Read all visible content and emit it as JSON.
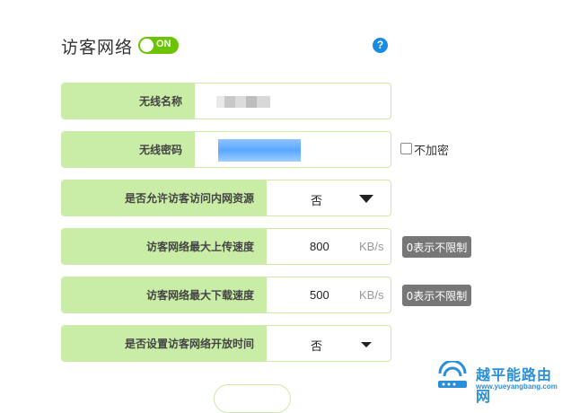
{
  "header": {
    "title": "访客网络",
    "toggle_label": "ON",
    "help_symbol": "?"
  },
  "fields": {
    "ssid": {
      "label": "无线名称"
    },
    "password": {
      "label": "无线密码",
      "no_encrypt_label": "不加密"
    },
    "intranet_access": {
      "label": "是否允许访客访问内网资源",
      "value": "否"
    },
    "upload_limit": {
      "label": "访客网络最大上传速度",
      "value": "800",
      "unit": "KB/s",
      "hint": "0表示不限制"
    },
    "download_limit": {
      "label": "访客网络最大下载速度",
      "value": "500",
      "unit": "KB/s",
      "hint": "0表示不限制"
    },
    "open_time": {
      "label": "是否设置访客网络开放时间",
      "value": "否"
    }
  },
  "watermark": {
    "title": "越平能路由网",
    "site": "www.yueyangbang.com"
  },
  "colors": {
    "accent_green": "#6cc400",
    "label_bg": "#c9eda7",
    "border": "#cfe9a8",
    "help_blue": "#1a8be0",
    "badge_gray": "#777777"
  }
}
